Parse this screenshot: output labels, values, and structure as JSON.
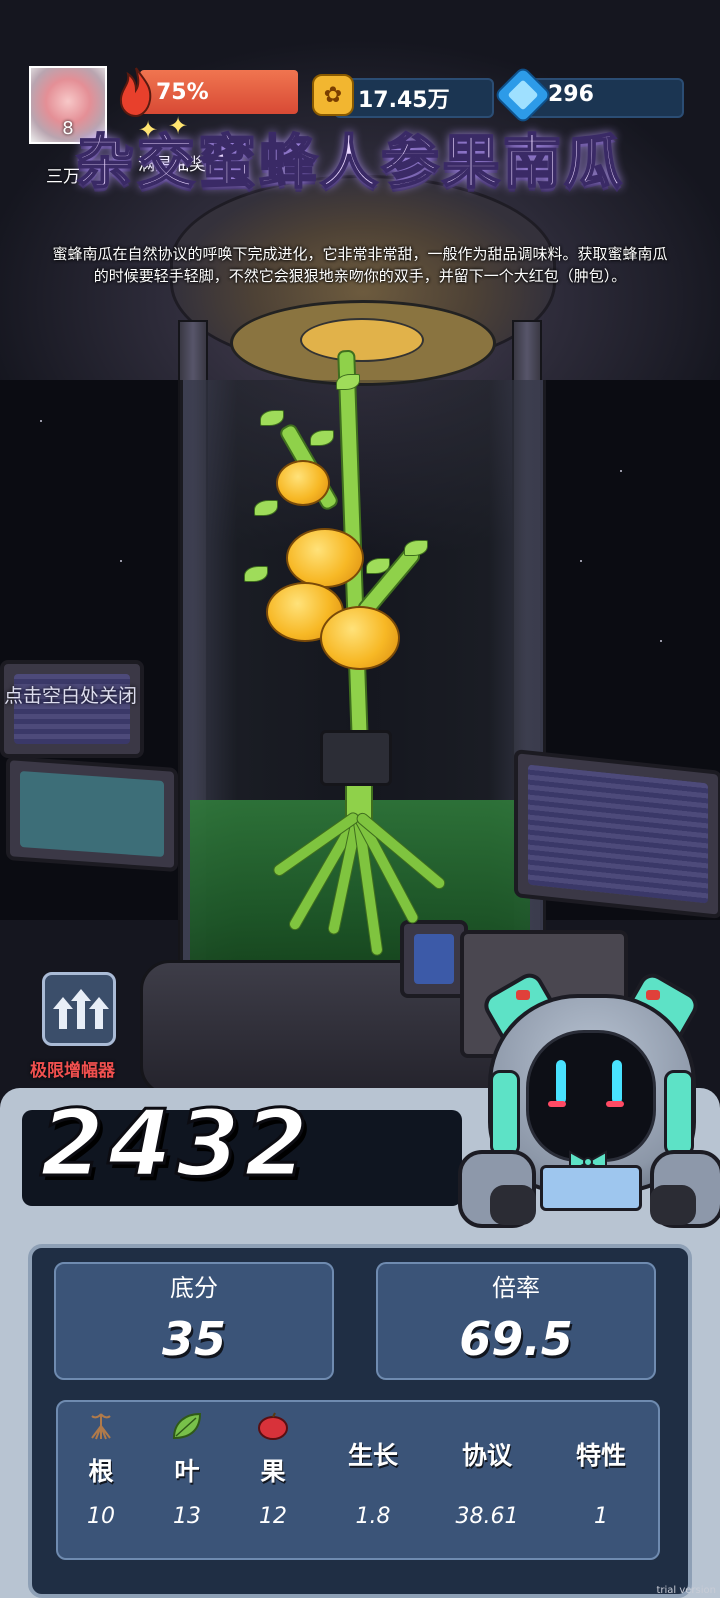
{
  "hud": {
    "player_level": "8",
    "player_subtitle": "三万",
    "energy_percent": "75%",
    "coins": "17.45万",
    "gems": "296",
    "lottery_label": "满星抽奖"
  },
  "item": {
    "title": "杂交蜜蜂人参果南瓜",
    "description": "蜜蜂南瓜在自然协议的呼唤下完成进化，它非常非常甜，一般作为甜品调味料。获取蜜蜂南瓜的时候要轻手轻脚，不然它会狠狠地亲吻你的双手，并留下一个大红包（肿包）。"
  },
  "close_hint": "点击空白处关闭",
  "amplifier": {
    "label": "极限增幅器",
    "icon": "triple-up-arrow-icon"
  },
  "score": {
    "total": "2432"
  },
  "stats": [
    {
      "label": "底分",
      "value": "35"
    },
    {
      "label": "倍率",
      "value": "69.5"
    }
  ],
  "attributes": [
    {
      "label": "根",
      "value": "10",
      "icon": "root-icon"
    },
    {
      "label": "叶",
      "value": "13",
      "icon": "leaf-icon"
    },
    {
      "label": "果",
      "value": "12",
      "icon": "apple-icon"
    },
    {
      "label": "生长",
      "value": "1.8"
    },
    {
      "label": "协议",
      "value": "38.61"
    },
    {
      "label": "特性",
      "value": "1"
    }
  ],
  "watermark": "trial version",
  "colors": {
    "energy_bar": "#d84a35",
    "amplifier_label": "#f0504f",
    "panel_card": "#3b5478"
  }
}
